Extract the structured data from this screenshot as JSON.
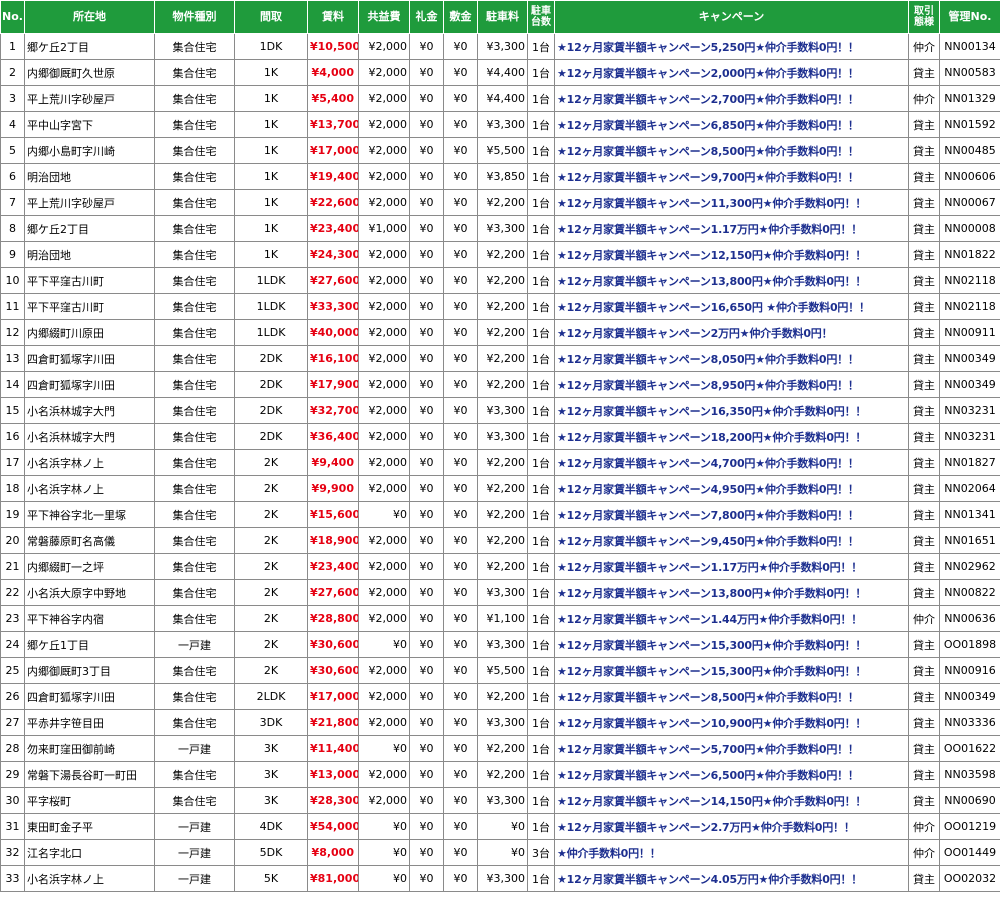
{
  "table": {
    "headers": {
      "no": "No.",
      "location": "所在地",
      "type": "物件種別",
      "layout": "間取",
      "rent": "賃料",
      "common": "共益費",
      "key_money": "礼金",
      "deposit": "敷金",
      "parking_fee": "駐車料",
      "parking_count": "駐車台数",
      "campaign": "キャンペーン",
      "transaction": "取引態様",
      "mgmt_no": "管理No."
    },
    "rows": [
      [
        "1",
        "郷ケ丘2丁目",
        "集合住宅",
        "1DK",
        "¥10,500",
        "¥2,000",
        "¥0",
        "¥0",
        "¥3,300",
        "1台",
        "★12ヶ月家賃半額キャンペーン5,250円★仲介手数料0円！！",
        "仲介",
        "NN00134"
      ],
      [
        "2",
        "内郷御厩町久世原",
        "集合住宅",
        "1K",
        "¥4,000",
        "¥2,000",
        "¥0",
        "¥0",
        "¥4,400",
        "1台",
        "★12ヶ月家賃半額キャンペーン2,000円★仲介手数料0円！！",
        "貸主",
        "NN00583"
      ],
      [
        "3",
        "平上荒川字砂屋戸",
        "集合住宅",
        "1K",
        "¥5,400",
        "¥2,000",
        "¥0",
        "¥0",
        "¥4,400",
        "1台",
        "★12ヶ月家賃半額キャンペーン2,700円★仲介手数料0円！！",
        "仲介",
        "NN01329"
      ],
      [
        "4",
        "平中山字宮下",
        "集合住宅",
        "1K",
        "¥13,700",
        "¥2,000",
        "¥0",
        "¥0",
        "¥3,300",
        "1台",
        "★12ヶ月家賃半額キャンペーン6,850円★仲介手数料0円！！",
        "貸主",
        "NN01592"
      ],
      [
        "5",
        "内郷小島町字川崎",
        "集合住宅",
        "1K",
        "¥17,000",
        "¥2,000",
        "¥0",
        "¥0",
        "¥5,500",
        "1台",
        "★12ヶ月家賃半額キャンペーン8,500円★仲介手数料0円！！",
        "貸主",
        "NN00485"
      ],
      [
        "6",
        "明治団地",
        "集合住宅",
        "1K",
        "¥19,400",
        "¥2,000",
        "¥0",
        "¥0",
        "¥3,850",
        "1台",
        "★12ヶ月家賃半額キャンペーン9,700円★仲介手数料0円！！",
        "貸主",
        "NN00606"
      ],
      [
        "7",
        "平上荒川字砂屋戸",
        "集合住宅",
        "1K",
        "¥22,600",
        "¥2,000",
        "¥0",
        "¥0",
        "¥2,200",
        "1台",
        "★12ヶ月家賃半額キャンペーン11,300円★仲介手数料0円！！",
        "貸主",
        "NN00067"
      ],
      [
        "8",
        "郷ケ丘2丁目",
        "集合住宅",
        "1K",
        "¥23,400",
        "¥1,000",
        "¥0",
        "¥0",
        "¥3,300",
        "1台",
        "★12ヶ月家賃半額キャンペーン1.17万円★仲介手数料0円！！",
        "貸主",
        "NN00008"
      ],
      [
        "9",
        "明治団地",
        "集合住宅",
        "1K",
        "¥24,300",
        "¥2,000",
        "¥0",
        "¥0",
        "¥2,200",
        "1台",
        "★12ヶ月家賃半額キャンペーン12,150円★仲介手数料0円！！",
        "貸主",
        "NN01822"
      ],
      [
        "10",
        "平下平窪古川町",
        "集合住宅",
        "1LDK",
        "¥27,600",
        "¥2,000",
        "¥0",
        "¥0",
        "¥2,200",
        "1台",
        "★12ヶ月家賃半額キャンペーン13,800円★仲介手数料0円！！",
        "貸主",
        "NN02118"
      ],
      [
        "11",
        "平下平窪古川町",
        "集合住宅",
        "1LDK",
        "¥33,300",
        "¥2,000",
        "¥0",
        "¥0",
        "¥2,200",
        "1台",
        "★12ヶ月家賃半額キャンペーン16,650円 ★仲介手数料0円！！",
        "貸主",
        "NN02118"
      ],
      [
        "12",
        "内郷綴町川原田",
        "集合住宅",
        "1LDK",
        "¥40,000",
        "¥2,000",
        "¥0",
        "¥0",
        "¥2,200",
        "1台",
        "★12ヶ月家賃半額キャンペーン2万円★仲介手数料0円！",
        "貸主",
        "NN00911"
      ],
      [
        "13",
        "四倉町狐塚字川田",
        "集合住宅",
        "2DK",
        "¥16,100",
        "¥2,000",
        "¥0",
        "¥0",
        "¥2,200",
        "1台",
        "★12ヶ月家賃半額キャンペーン8,050円★仲介手数料0円！！",
        "貸主",
        "NN00349"
      ],
      [
        "14",
        "四倉町狐塚字川田",
        "集合住宅",
        "2DK",
        "¥17,900",
        "¥2,000",
        "¥0",
        "¥0",
        "¥2,200",
        "1台",
        "★12ヶ月家賃半額キャンペーン8,950円★仲介手数料0円！！",
        "貸主",
        "NN00349"
      ],
      [
        "15",
        "小名浜林城字大門",
        "集合住宅",
        "2DK",
        "¥32,700",
        "¥2,000",
        "¥0",
        "¥0",
        "¥3,300",
        "1台",
        "★12ヶ月家賃半額キャンペーン16,350円★仲介手数料0円！！",
        "貸主",
        "NN03231"
      ],
      [
        "16",
        "小名浜林城字大門",
        "集合住宅",
        "2DK",
        "¥36,400",
        "¥2,000",
        "¥0",
        "¥0",
        "¥3,300",
        "1台",
        "★12ヶ月家賃半額キャンペーン18,200円★仲介手数料0円！！",
        "貸主",
        "NN03231"
      ],
      [
        "17",
        "小名浜字林ノ上",
        "集合住宅",
        "2K",
        "¥9,400",
        "¥2,000",
        "¥0",
        "¥0",
        "¥2,200",
        "1台",
        "★12ヶ月家賃半額キャンペーン4,700円★仲介手数料0円！！",
        "貸主",
        "NN01827"
      ],
      [
        "18",
        "小名浜字林ノ上",
        "集合住宅",
        "2K",
        "¥9,900",
        "¥2,000",
        "¥0",
        "¥0",
        "¥2,200",
        "1台",
        "★12ヶ月家賃半額キャンペーン4,950円★仲介手数料0円！！",
        "貸主",
        "NN02064"
      ],
      [
        "19",
        "平下神谷字北一里塚",
        "集合住宅",
        "2K",
        "¥15,600",
        "¥0",
        "¥0",
        "¥0",
        "¥2,200",
        "1台",
        "★12ヶ月家賃半額キャンペーン7,800円★仲介手数料0円！！",
        "貸主",
        "NN01341"
      ],
      [
        "20",
        "常磐藤原町名高儀",
        "集合住宅",
        "2K",
        "¥18,900",
        "¥2,000",
        "¥0",
        "¥0",
        "¥2,200",
        "1台",
        "★12ヶ月家賃半額キャンペーン9,450円★仲介手数料0円！！",
        "貸主",
        "NN01651"
      ],
      [
        "21",
        "内郷綴町一之坪",
        "集合住宅",
        "2K",
        "¥23,400",
        "¥2,000",
        "¥0",
        "¥0",
        "¥2,200",
        "1台",
        "★12ヶ月家賃半額キャンペーン1.17万円★仲介手数料0円！！",
        "貸主",
        "NN02962"
      ],
      [
        "22",
        "小名浜大原字中野地",
        "集合住宅",
        "2K",
        "¥27,600",
        "¥2,000",
        "¥0",
        "¥0",
        "¥3,300",
        "1台",
        "★12ヶ月家賃半額キャンペーン13,800円★仲介手数料0円！！",
        "貸主",
        "NN00822"
      ],
      [
        "23",
        "平下神谷字内宿",
        "集合住宅",
        "2K",
        "¥28,800",
        "¥2,000",
        "¥0",
        "¥0",
        "¥1,100",
        "1台",
        "★12ヶ月家賃半額キャンペーン1.44万円★仲介手数料0円！！",
        "仲介",
        "NN00636"
      ],
      [
        "24",
        "郷ケ丘1丁目",
        "一戸建",
        "2K",
        "¥30,600",
        "¥0",
        "¥0",
        "¥0",
        "¥3,300",
        "1台",
        "★12ヶ月家賃半額キャンペーン15,300円★仲介手数料0円！！",
        "貸主",
        "OO01898"
      ],
      [
        "25",
        "内郷御厩町3丁目",
        "集合住宅",
        "2K",
        "¥30,600",
        "¥2,000",
        "¥0",
        "¥0",
        "¥5,500",
        "1台",
        "★12ヶ月家賃半額キャンペーン15,300円★仲介手数料0円！！",
        "貸主",
        "NN00916"
      ],
      [
        "26",
        "四倉町狐塚字川田",
        "集合住宅",
        "2LDK",
        "¥17,000",
        "¥2,000",
        "¥0",
        "¥0",
        "¥2,200",
        "1台",
        "★12ヶ月家賃半額キャンペーン8,500円★仲介手数料0円！！",
        "貸主",
        "NN00349"
      ],
      [
        "27",
        "平赤井字笹目田",
        "集合住宅",
        "3DK",
        "¥21,800",
        "¥2,000",
        "¥0",
        "¥0",
        "¥3,300",
        "1台",
        "★12ヶ月家賃半額キャンペーン10,900円★仲介手数料0円！！",
        "貸主",
        "NN03336"
      ],
      [
        "28",
        "勿来町窪田御前崎",
        "一戸建",
        "3K",
        "¥11,400",
        "¥0",
        "¥0",
        "¥0",
        "¥2,200",
        "1台",
        "★12ヶ月家賃半額キャンペーン5,700円★仲介手数料0円！！",
        "貸主",
        "OO01622"
      ],
      [
        "29",
        "常磐下湯長谷町一町田",
        "集合住宅",
        "3K",
        "¥13,000",
        "¥2,000",
        "¥0",
        "¥0",
        "¥2,200",
        "1台",
        "★12ヶ月家賃半額キャンペーン6,500円★仲介手数料0円！！",
        "貸主",
        "NN03598"
      ],
      [
        "30",
        "平字桜町",
        "集合住宅",
        "3K",
        "¥28,300",
        "¥2,000",
        "¥0",
        "¥0",
        "¥3,300",
        "1台",
        "★12ヶ月家賃半額キャンペーン14,150円★仲介手数料0円！！",
        "貸主",
        "NN00690"
      ],
      [
        "31",
        "東田町金子平",
        "一戸建",
        "4DK",
        "¥54,000",
        "¥0",
        "¥0",
        "¥0",
        "¥0",
        "1台",
        "★12ヶ月家賃半額キャンペーン2.7万円★仲介手数料0円！！",
        "仲介",
        "OO01219"
      ],
      [
        "32",
        "江名字北口",
        "一戸建",
        "5DK",
        "¥8,000",
        "¥0",
        "¥0",
        "¥0",
        "¥0",
        "3台",
        "★仲介手数料0円！！",
        "仲介",
        "OO01449"
      ],
      [
        "33",
        "小名浜字林ノ上",
        "一戸建",
        "5K",
        "¥81,000",
        "¥0",
        "¥0",
        "¥0",
        "¥3,300",
        "1台",
        "★12ヶ月家賃半額キャンペーン4.05万円★仲介手数料0円！！",
        "貸主",
        "OO02032"
      ]
    ]
  },
  "colors": {
    "header_bg": "#1f9b3c",
    "rent_text": "#e60012",
    "campaign_text": "#1d2f8f"
  }
}
